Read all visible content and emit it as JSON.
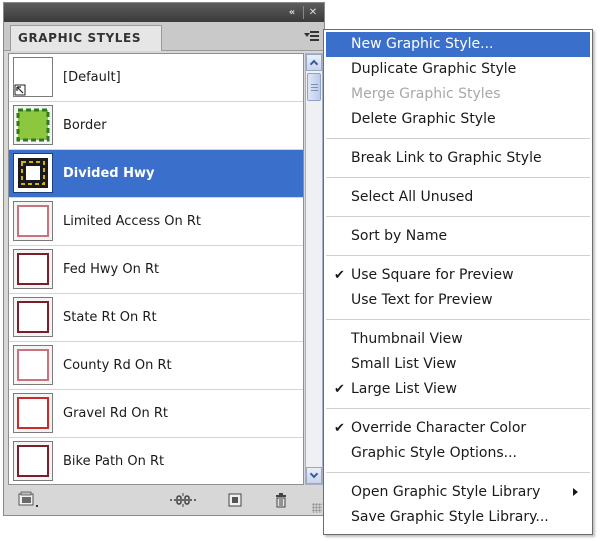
{
  "panel": {
    "tab_label": "GRAPHIC STYLES",
    "collapse_glyph": "«",
    "close_glyph": "✕",
    "styles": [
      {
        "label": "[Default]",
        "thumb": "default"
      },
      {
        "label": "Border",
        "thumb": "border"
      },
      {
        "label": "Divided Hwy",
        "thumb": "divided",
        "selected": true
      },
      {
        "label": "Limited Access On Rt",
        "thumb": "red-light"
      },
      {
        "label": "Fed Hwy On Rt",
        "thumb": "maroon"
      },
      {
        "label": "State Rt On Rt",
        "thumb": "maroon"
      },
      {
        "label": "County Rd On Rt",
        "thumb": "red-light"
      },
      {
        "label": "Gravel Rd On Rt",
        "thumb": "red"
      },
      {
        "label": "Bike Path On Rt",
        "thumb": "maroon-cut"
      }
    ],
    "bottom_icons": [
      "graphic-style-libraries-icon",
      "break-link-icon",
      "new-graphic-style-icon",
      "delete-icon"
    ]
  },
  "menu": {
    "items": [
      {
        "label": "New Graphic Style...",
        "highlight": true
      },
      {
        "label": "Duplicate Graphic Style"
      },
      {
        "label": "Merge Graphic Styles",
        "disabled": true
      },
      {
        "label": "Delete Graphic Style"
      },
      {
        "sep": true
      },
      {
        "label": "Break Link to Graphic Style"
      },
      {
        "sep": true
      },
      {
        "label": "Select All Unused"
      },
      {
        "sep": true
      },
      {
        "label": "Sort by Name"
      },
      {
        "sep": true
      },
      {
        "label": "Use Square for Preview",
        "checked": true
      },
      {
        "label": "Use Text for Preview"
      },
      {
        "sep": true
      },
      {
        "label": "Thumbnail View"
      },
      {
        "label": "Small List View"
      },
      {
        "label": "Large List View",
        "checked": true
      },
      {
        "sep": true
      },
      {
        "label": "Override Character Color",
        "checked": true
      },
      {
        "label": "Graphic Style Options..."
      },
      {
        "sep": true
      },
      {
        "label": "Open Graphic Style Library",
        "submenu": true
      },
      {
        "label": "Save Graphic Style Library..."
      }
    ]
  },
  "colors": {
    "selection": "#3a6fcc",
    "border_fill": "#8dc63f",
    "border_dash": "#2d7a1f",
    "divided_frame": "#1a1a1a",
    "divided_dash": "#d4b400",
    "red_light": "#c9737a",
    "maroon": "#7a1f2a",
    "red": "#cc2b2b"
  }
}
